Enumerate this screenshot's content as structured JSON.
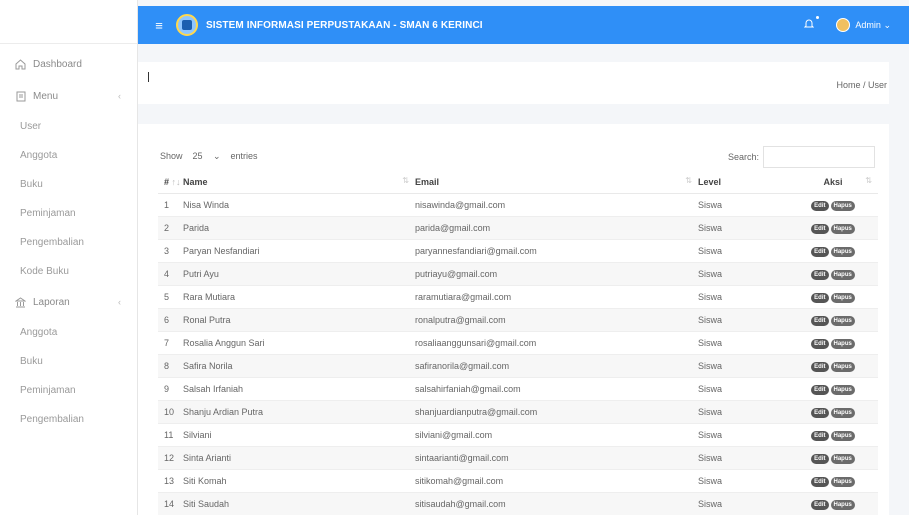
{
  "header": {
    "title": "SISTEM INFORMASI PERPUSTAKAAN - SMAN 6 KERINCI",
    "user_label": "Admin",
    "menu_icon": "hamburger-icon",
    "bell_icon": "bell-icon"
  },
  "sidebar": {
    "dashboard": "Dashboard",
    "menu": "Menu",
    "menu_items": [
      "User",
      "Anggota",
      "Buku",
      "Peminjaman",
      "Pengembalian",
      "Kode Buku"
    ],
    "laporan": "Laporan",
    "laporan_items": [
      "Anggota",
      "Buku",
      "Peminjaman",
      "Pengembalian"
    ]
  },
  "breadcrumb": {
    "text": "Home / User"
  },
  "table_controls": {
    "show_label": "Show",
    "entries_value": "25",
    "entries_label": "entries",
    "search_label": "Search:"
  },
  "table": {
    "columns": [
      "#",
      "Name",
      "Email",
      "Level",
      "Aksi"
    ],
    "edit_label": "Edit",
    "delete_label": "Hapus",
    "rows": [
      {
        "no": "1",
        "name": "Nisa Winda",
        "email": "nisawinda@gmail.com",
        "level": "Siswa"
      },
      {
        "no": "2",
        "name": "Parida",
        "email": "parida@gmail.com",
        "level": "Siswa"
      },
      {
        "no": "3",
        "name": "Paryan Nesfandiari",
        "email": "paryannesfandiari@gmail.com",
        "level": "Siswa"
      },
      {
        "no": "4",
        "name": "Putri Ayu",
        "email": "putriayu@gmail.com",
        "level": "Siswa"
      },
      {
        "no": "5",
        "name": "Rara Mutiara",
        "email": "raramutiara@gmail.com",
        "level": "Siswa"
      },
      {
        "no": "6",
        "name": "Ronal Putra",
        "email": "ronalputra@gmail.com",
        "level": "Siswa"
      },
      {
        "no": "7",
        "name": "Rosalia Anggun Sari",
        "email": "rosaliaanggunsari@gmail.com",
        "level": "Siswa"
      },
      {
        "no": "8",
        "name": "Safira Norila",
        "email": "safiranorila@gmail.com",
        "level": "Siswa"
      },
      {
        "no": "9",
        "name": "Salsah Irfaniah",
        "email": "salsahirfaniah@gmail.com",
        "level": "Siswa"
      },
      {
        "no": "10",
        "name": "Shanju Ardian Putra",
        "email": "shanjuardianputra@gmail.com",
        "level": "Siswa"
      },
      {
        "no": "11",
        "name": "Silviani",
        "email": "silviani@gmail.com",
        "level": "Siswa"
      },
      {
        "no": "12",
        "name": "Sinta Arianti",
        "email": "sintaarianti@gmail.com",
        "level": "Siswa"
      },
      {
        "no": "13",
        "name": "Siti Komah",
        "email": "sitikomah@gmail.com",
        "level": "Siswa"
      },
      {
        "no": "14",
        "name": "Siti Saudah",
        "email": "sitisaudah@gmail.com",
        "level": "Siswa"
      }
    ]
  },
  "colors": {
    "header_bg": "#2f8ff7",
    "sidebar_bg": "#ffffff",
    "page_bg": "#f4f6f9"
  }
}
